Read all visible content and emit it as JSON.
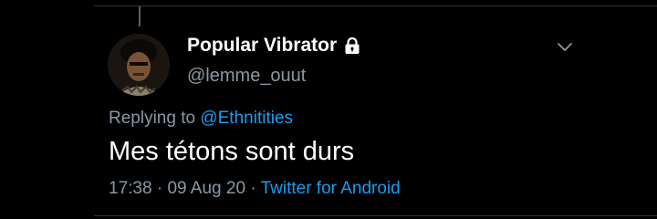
{
  "tweet": {
    "author": {
      "display_name": "Popular Vibrator",
      "handle": "@lemme_ouut",
      "protected_icon": "lock-icon",
      "avatar_icon": "avatar-photo"
    },
    "reply": {
      "prefix": "Replying to",
      "mention": "@Ethnitities"
    },
    "text": "Mes tétons sont durs",
    "meta": {
      "time": "17:38",
      "separator": "·",
      "date": "09 Aug 20",
      "source": "Twitter for Android"
    },
    "menu_icon": "chevron-down-icon"
  },
  "colors": {
    "background": "#000000",
    "primary_text": "#ffffff",
    "secondary_text": "#8b98a5",
    "link": "#1d9bf0",
    "divider": "#2f3336"
  }
}
